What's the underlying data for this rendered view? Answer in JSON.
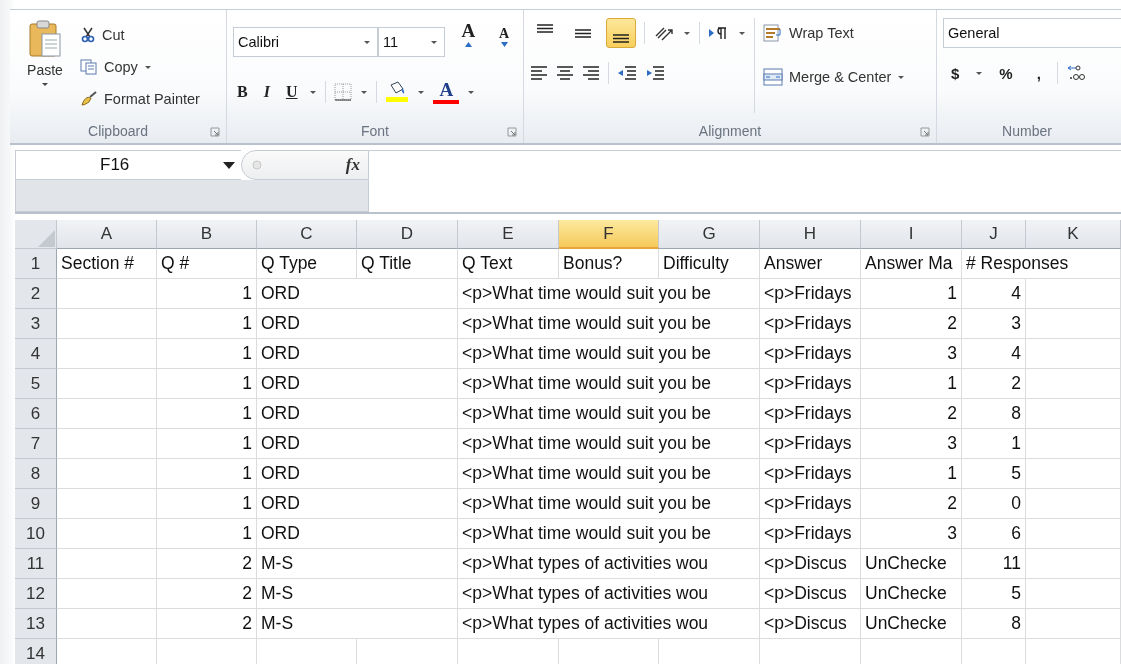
{
  "ribbon": {
    "clipboard": {
      "label": "Clipboard",
      "paste": "Paste",
      "cut": "Cut",
      "copy": "Copy",
      "format_painter": "Format Painter"
    },
    "font": {
      "label": "Font",
      "font_name": "Calibri",
      "font_size": "11",
      "grow": "A",
      "shrink": "A",
      "bold": "B",
      "italic": "I",
      "underline": "U",
      "font_color": "A"
    },
    "alignment": {
      "label": "Alignment",
      "wrap_text": "Wrap Text",
      "merge_center": "Merge & Center",
      "vertical_align": [
        {
          "kind": "top",
          "selected": false
        },
        {
          "kind": "middle",
          "selected": false
        },
        {
          "kind": "bottom",
          "selected": true
        }
      ]
    },
    "number": {
      "label": "Number",
      "format": "General",
      "currency": "$",
      "percent": "%",
      "comma": ","
    }
  },
  "formula_bar": {
    "name_box": "F16",
    "fx": "fx"
  },
  "sheet": {
    "columns": [
      {
        "letter": "A",
        "selected": false
      },
      {
        "letter": "B",
        "selected": false
      },
      {
        "letter": "C",
        "selected": false
      },
      {
        "letter": "D",
        "selected": false
      },
      {
        "letter": "E",
        "selected": false
      },
      {
        "letter": "F",
        "selected": true
      },
      {
        "letter": "G",
        "selected": false
      },
      {
        "letter": "H",
        "selected": false
      },
      {
        "letter": "I",
        "selected": false
      },
      {
        "letter": "J",
        "selected": false
      },
      {
        "letter": "K",
        "selected": false
      }
    ],
    "rows": [
      {
        "number": "1",
        "cells": {
          "section": {
            "kind": "text",
            "text": "Section #"
          },
          "q_num": {
            "kind": "text",
            "text": "Q #"
          },
          "q_type": {
            "kind": "text",
            "text": "Q Type"
          },
          "q_title": {
            "kind": "text",
            "text": "Q Title"
          },
          "q_text": {
            "kind": "text",
            "text": "Q Text"
          },
          "bonus": {
            "kind": "text",
            "text": "Bonus?"
          },
          "difficulty": {
            "kind": "text",
            "text": "Difficulty"
          },
          "answer": {
            "kind": "text",
            "text": "Answer"
          },
          "answer_match": {
            "kind": "text",
            "text": "Answer Ma"
          },
          "responses": {
            "kind": "text",
            "text": "# Responses"
          }
        }
      },
      {
        "number": "2",
        "cells": {
          "q_num": {
            "kind": "number",
            "text": "1"
          },
          "q_type": {
            "kind": "text",
            "text": "ORD"
          },
          "q_text": {
            "kind": "text",
            "text": "<p>What time would suit you be"
          },
          "answer": {
            "kind": "text",
            "text": "<p>Fridays"
          },
          "answer_match": {
            "kind": "number",
            "text": "1"
          },
          "responses": {
            "kind": "number",
            "text": "4"
          }
        }
      },
      {
        "number": "3",
        "cells": {
          "q_num": {
            "kind": "number",
            "text": "1"
          },
          "q_type": {
            "kind": "text",
            "text": "ORD"
          },
          "q_text": {
            "kind": "text",
            "text": "<p>What time would suit you be"
          },
          "answer": {
            "kind": "text",
            "text": "<p>Fridays"
          },
          "answer_match": {
            "kind": "number",
            "text": "2"
          },
          "responses": {
            "kind": "number",
            "text": "3"
          }
        }
      },
      {
        "number": "4",
        "cells": {
          "q_num": {
            "kind": "number",
            "text": "1"
          },
          "q_type": {
            "kind": "text",
            "text": "ORD"
          },
          "q_text": {
            "kind": "text",
            "text": "<p>What time would suit you be"
          },
          "answer": {
            "kind": "text",
            "text": "<p>Fridays"
          },
          "answer_match": {
            "kind": "number",
            "text": "3"
          },
          "responses": {
            "kind": "number",
            "text": "4"
          }
        }
      },
      {
        "number": "5",
        "cells": {
          "q_num": {
            "kind": "number",
            "text": "1"
          },
          "q_type": {
            "kind": "text",
            "text": "ORD"
          },
          "q_text": {
            "kind": "text",
            "text": "<p>What time would suit you be"
          },
          "answer": {
            "kind": "text",
            "text": "<p>Fridays"
          },
          "answer_match": {
            "kind": "number",
            "text": "1"
          },
          "responses": {
            "kind": "number",
            "text": "2"
          }
        }
      },
      {
        "number": "6",
        "cells": {
          "q_num": {
            "kind": "number",
            "text": "1"
          },
          "q_type": {
            "kind": "text",
            "text": "ORD"
          },
          "q_text": {
            "kind": "text",
            "text": "<p>What time would suit you be"
          },
          "answer": {
            "kind": "text",
            "text": "<p>Fridays"
          },
          "answer_match": {
            "kind": "number",
            "text": "2"
          },
          "responses": {
            "kind": "number",
            "text": "8"
          }
        }
      },
      {
        "number": "7",
        "cells": {
          "q_num": {
            "kind": "number",
            "text": "1"
          },
          "q_type": {
            "kind": "text",
            "text": "ORD"
          },
          "q_text": {
            "kind": "text",
            "text": "<p>What time would suit you be"
          },
          "answer": {
            "kind": "text",
            "text": "<p>Fridays"
          },
          "answer_match": {
            "kind": "number",
            "text": "3"
          },
          "responses": {
            "kind": "number",
            "text": "1"
          }
        }
      },
      {
        "number": "8",
        "cells": {
          "q_num": {
            "kind": "number",
            "text": "1"
          },
          "q_type": {
            "kind": "text",
            "text": "ORD"
          },
          "q_text": {
            "kind": "text",
            "text": "<p>What time would suit you be"
          },
          "answer": {
            "kind": "text",
            "text": "<p>Fridays"
          },
          "answer_match": {
            "kind": "number",
            "text": "1"
          },
          "responses": {
            "kind": "number",
            "text": "5"
          }
        }
      },
      {
        "number": "9",
        "cells": {
          "q_num": {
            "kind": "number",
            "text": "1"
          },
          "q_type": {
            "kind": "text",
            "text": "ORD"
          },
          "q_text": {
            "kind": "text",
            "text": "<p>What time would suit you be"
          },
          "answer": {
            "kind": "text",
            "text": "<p>Fridays"
          },
          "answer_match": {
            "kind": "number",
            "text": "2"
          },
          "responses": {
            "kind": "number",
            "text": "0"
          }
        }
      },
      {
        "number": "10",
        "cells": {
          "q_num": {
            "kind": "number",
            "text": "1"
          },
          "q_type": {
            "kind": "text",
            "text": "ORD"
          },
          "q_text": {
            "kind": "text",
            "text": "<p>What time would suit you be"
          },
          "answer": {
            "kind": "text",
            "text": "<p>Fridays"
          },
          "answer_match": {
            "kind": "number",
            "text": "3"
          },
          "responses": {
            "kind": "number",
            "text": "6"
          }
        }
      },
      {
        "number": "11",
        "cells": {
          "q_num": {
            "kind": "number",
            "text": "2"
          },
          "q_type": {
            "kind": "text",
            "text": "M-S"
          },
          "q_text": {
            "kind": "text",
            "text": "<p>What types of activities wou"
          },
          "answer": {
            "kind": "text",
            "text": "<p>Discus"
          },
          "answer_match": {
            "kind": "text",
            "text": "UnChecke"
          },
          "responses": {
            "kind": "number",
            "text": "11"
          }
        }
      },
      {
        "number": "12",
        "cells": {
          "q_num": {
            "kind": "number",
            "text": "2"
          },
          "q_type": {
            "kind": "text",
            "text": "M-S"
          },
          "q_text": {
            "kind": "text",
            "text": "<p>What types of activities wou"
          },
          "answer": {
            "kind": "text",
            "text": "<p>Discus"
          },
          "answer_match": {
            "kind": "text",
            "text": "UnChecke"
          },
          "responses": {
            "kind": "number",
            "text": "5"
          }
        }
      },
      {
        "number": "13",
        "cells": {
          "q_num": {
            "kind": "number",
            "text": "2"
          },
          "q_type": {
            "kind": "text",
            "text": "M-S"
          },
          "q_text": {
            "kind": "text",
            "text": "<p>What types of activities wou"
          },
          "answer": {
            "kind": "text",
            "text": "<p>Discus"
          },
          "answer_match": {
            "kind": "text",
            "text": "UnChecke"
          },
          "responses": {
            "kind": "number",
            "text": "8"
          }
        }
      },
      {
        "number": "14",
        "cells": {}
      }
    ]
  }
}
